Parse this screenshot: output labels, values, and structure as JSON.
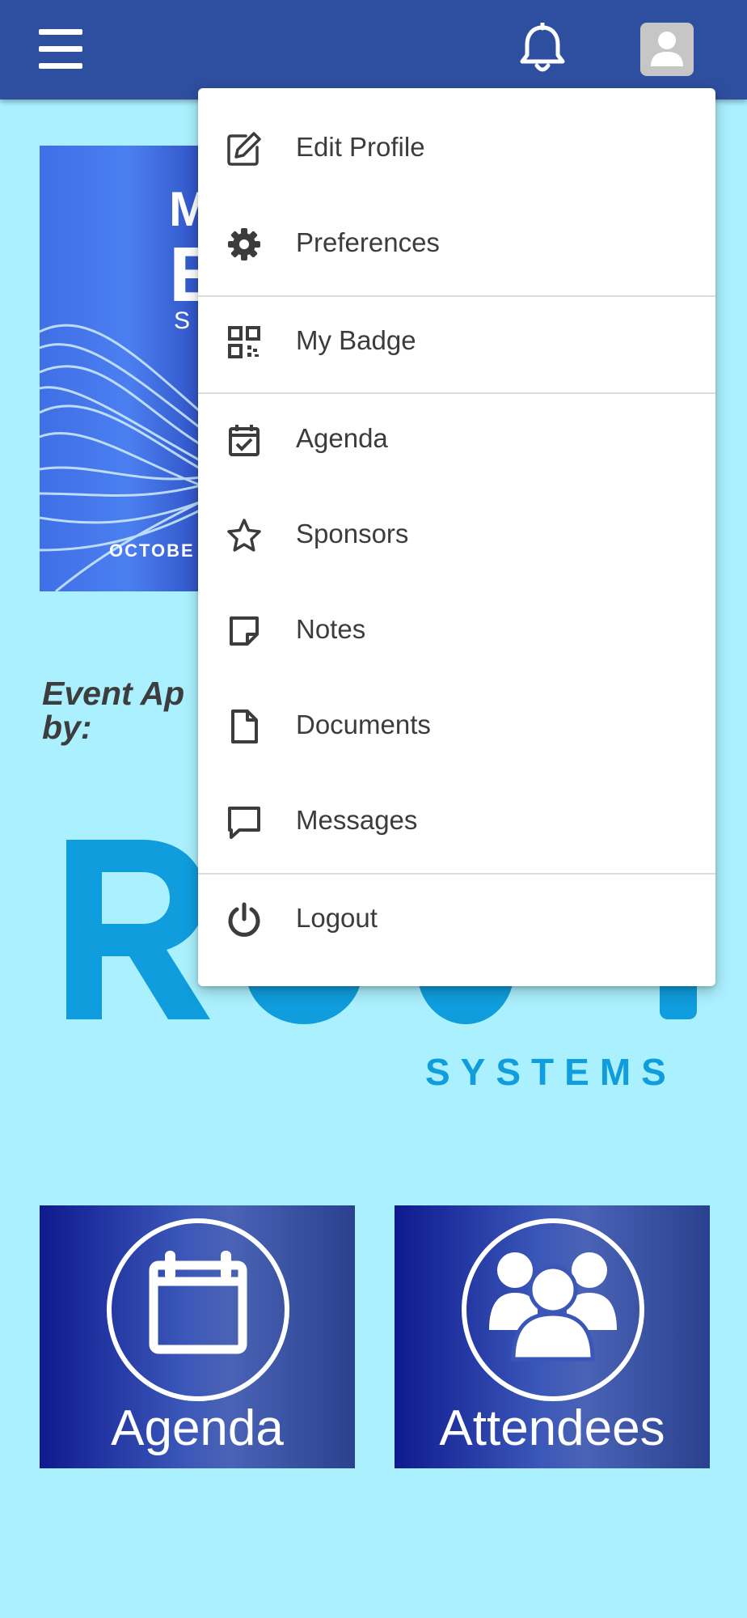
{
  "header": {
    "menu_icon": "hamburger-icon",
    "notifications_icon": "bell-icon",
    "profile_icon": "user-avatar-icon",
    "background_color": "#2e4e9f"
  },
  "banner": {
    "line1": "M",
    "line2": "E",
    "line3": "S",
    "date": "OCTOBE"
  },
  "powered_by": {
    "text_line1": "Event Ap",
    "text_line2": "by:"
  },
  "logo": {
    "brand": "Revel",
    "tagline": "SYSTEMS",
    "color": "#0f9ddd"
  },
  "tiles": [
    {
      "label": "Agenda",
      "icon": "calendar-icon"
    },
    {
      "label": "Attendees",
      "icon": "people-group-icon"
    }
  ],
  "dropdown_menu": {
    "items": [
      {
        "label": "Edit Profile",
        "icon": "edit-icon"
      },
      {
        "label": "Preferences",
        "icon": "gear-icon"
      },
      {
        "label": "My Badge",
        "icon": "qr-code-icon"
      },
      {
        "label": "Agenda",
        "icon": "calendar-check-icon"
      },
      {
        "label": "Sponsors",
        "icon": "star-icon"
      },
      {
        "label": "Notes",
        "icon": "sticky-note-icon"
      },
      {
        "label": "Documents",
        "icon": "document-icon"
      },
      {
        "label": "Messages",
        "icon": "message-icon"
      },
      {
        "label": "Logout",
        "icon": "power-icon"
      }
    ]
  },
  "colors": {
    "page_background": "#aaf0fe",
    "tile_dark": "#0e1a8e",
    "tile_mid": "#4a63b6"
  }
}
